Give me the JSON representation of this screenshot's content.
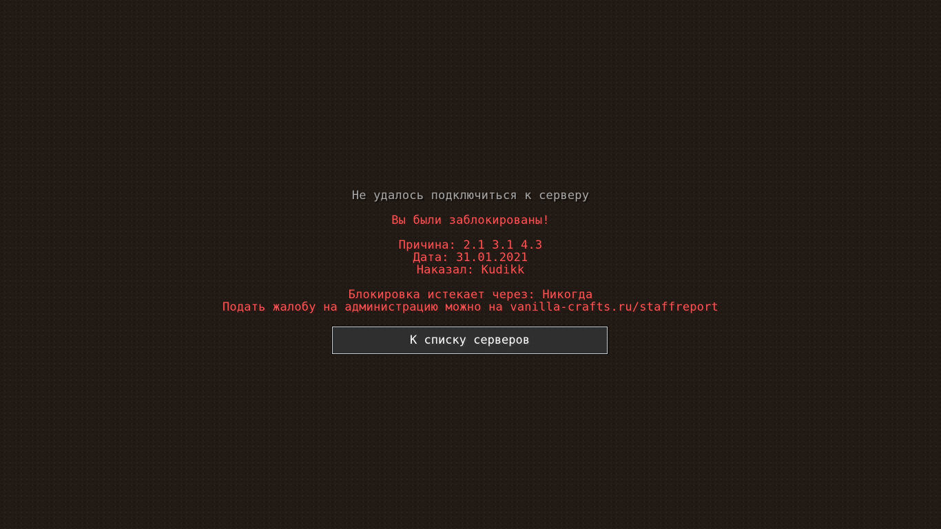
{
  "screen": {
    "title": "Не удалось подключиться к серверу",
    "messages": [
      "Вы были заблокированы!",
      "Причина: 2.1 3.1 4.3",
      "Дата: 31.01.2021",
      "Наказал: Kudikk",
      "Блокировка истекает через: Никогда",
      "Подать жалобу на администрацию можно на vanilla-crafts.ru/staffreport"
    ],
    "back_button_label": "К списку серверов"
  },
  "colors": {
    "background": "#221a14",
    "title_text": "#a8a8a8",
    "message_text": "#ff5555",
    "button_background": "#2f2f2f",
    "button_text": "#ffffff"
  }
}
